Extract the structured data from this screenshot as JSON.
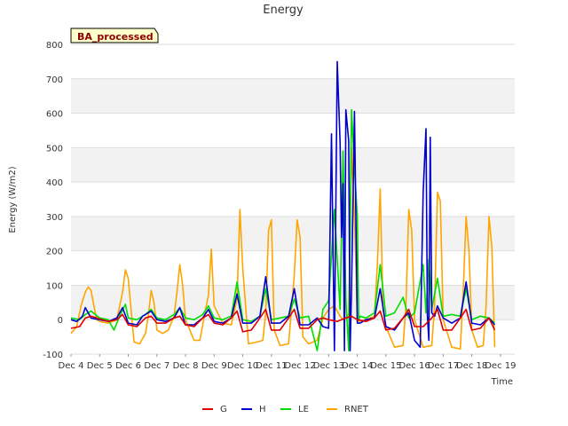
{
  "chart_data": {
    "type": "line",
    "title": "Energy",
    "xlabel": "Time",
    "ylabel": "Energy (W/m2)",
    "badge": "BA_processed",
    "ylim": [
      -100,
      800
    ],
    "yticks": [
      -100,
      0,
      100,
      200,
      300,
      400,
      500,
      600,
      700,
      800
    ],
    "xlim": [
      0,
      15.5
    ],
    "xtick_labels": [
      "Dec 4",
      "Dec 5",
      "Dec 6",
      "Dec 7",
      "Dec 8",
      "Dec 9",
      "Dec 10",
      "Dec 11",
      "Dec 12",
      "Dec 13",
      "Dec 14",
      "Dec 15",
      "Dec 16",
      "Dec 17",
      "Dec 18",
      "Dec 19"
    ],
    "legend_position": "bottom",
    "grid": true,
    "series": [
      {
        "name": "G",
        "color": "#dd0000",
        "x": [
          0.0,
          0.3,
          0.5,
          0.7,
          1.0,
          1.3,
          1.6,
          1.8,
          2.0,
          2.3,
          2.6,
          2.8,
          3.0,
          3.3,
          3.6,
          3.8,
          4.0,
          4.3,
          4.6,
          4.8,
          5.0,
          5.3,
          5.6,
          5.8,
          6.0,
          6.3,
          6.6,
          6.8,
          7.0,
          7.3,
          7.6,
          7.8,
          8.0,
          8.3,
          8.6,
          8.8,
          9.0,
          9.3,
          9.6,
          9.8,
          10.0,
          10.3,
          10.6,
          10.8,
          11.0,
          11.3,
          11.6,
          11.8,
          12.0,
          12.3,
          12.6,
          12.8,
          13.0,
          13.3,
          13.6,
          13.8,
          14.0,
          14.3,
          14.6,
          14.8
        ],
        "y": [
          -25,
          -20,
          5,
          10,
          2,
          -5,
          0,
          15,
          -15,
          -20,
          5,
          10,
          -10,
          -10,
          5,
          10,
          -15,
          -20,
          5,
          15,
          -10,
          -15,
          5,
          25,
          -35,
          -30,
          5,
          30,
          -30,
          -30,
          5,
          30,
          -25,
          -25,
          0,
          5,
          0,
          -5,
          5,
          10,
          0,
          -5,
          5,
          25,
          -30,
          -25,
          5,
          30,
          -20,
          -20,
          5,
          30,
          -30,
          -30,
          5,
          30,
          -30,
          -25,
          5,
          -30
        ]
      },
      {
        "name": "H",
        "color": "#0000cc",
        "x": [
          0.0,
          0.2,
          0.4,
          0.5,
          0.7,
          1.0,
          1.3,
          1.6,
          1.8,
          2.0,
          2.3,
          2.5,
          2.8,
          3.0,
          3.3,
          3.6,
          3.8,
          4.0,
          4.3,
          4.6,
          4.8,
          5.0,
          5.3,
          5.6,
          5.8,
          6.0,
          6.3,
          6.6,
          6.8,
          7.0,
          7.3,
          7.6,
          7.8,
          8.0,
          8.3,
          8.6,
          8.8,
          9.0,
          9.1,
          9.2,
          9.3,
          9.4,
          9.45,
          9.5,
          9.55,
          9.6,
          9.7,
          9.75,
          9.8,
          9.9,
          10.0,
          10.1,
          10.2,
          10.3,
          10.6,
          10.8,
          11.0,
          11.3,
          11.6,
          11.8,
          12.0,
          12.2,
          12.3,
          12.4,
          12.45,
          12.5,
          12.55,
          12.6,
          12.7,
          12.8,
          13.0,
          13.3,
          13.6,
          13.8,
          14.0,
          14.3,
          14.6,
          14.8
        ],
        "y": [
          0,
          -5,
          10,
          35,
          5,
          0,
          -5,
          5,
          35,
          -10,
          -15,
          10,
          25,
          0,
          -5,
          5,
          35,
          -15,
          -15,
          5,
          30,
          -5,
          -10,
          5,
          75,
          -10,
          -10,
          10,
          125,
          -10,
          -10,
          10,
          90,
          -15,
          -15,
          5,
          -20,
          -25,
          540,
          -90,
          750,
          515,
          240,
          395,
          -90,
          610,
          520,
          -90,
          90,
          605,
          -10,
          -10,
          -5,
          0,
          5,
          90,
          -20,
          -30,
          5,
          20,
          -60,
          -80,
          370,
          555,
          10,
          -60,
          530,
          20,
          10,
          40,
          5,
          -10,
          5,
          110,
          -10,
          -15,
          5,
          -15
        ]
      },
      {
        "name": "LE",
        "color": "#00dd00",
        "x": [
          0.0,
          0.3,
          0.5,
          0.7,
          1.0,
          1.3,
          1.5,
          1.7,
          1.9,
          2.0,
          2.3,
          2.6,
          2.8,
          3.0,
          3.3,
          3.6,
          3.8,
          4.0,
          4.3,
          4.6,
          4.8,
          5.0,
          5.3,
          5.6,
          5.8,
          6.0,
          6.3,
          6.6,
          6.8,
          7.0,
          7.3,
          7.6,
          7.8,
          8.0,
          8.3,
          8.6,
          8.8,
          9.0,
          9.2,
          9.4,
          9.5,
          9.6,
          9.7,
          9.8,
          9.9,
          10.0,
          10.05,
          10.1,
          10.3,
          10.6,
          10.8,
          11.0,
          11.3,
          11.6,
          11.8,
          12.0,
          12.3,
          12.4,
          12.5,
          12.6,
          12.8,
          13.0,
          13.3,
          13.6,
          13.8,
          14.0,
          14.3,
          14.6,
          14.8
        ],
        "y": [
          5,
          0,
          15,
          25,
          5,
          0,
          -30,
          10,
          45,
          5,
          0,
          15,
          30,
          5,
          0,
          15,
          35,
          5,
          0,
          15,
          40,
          5,
          0,
          10,
          110,
          0,
          -5,
          10,
          90,
          0,
          5,
          10,
          60,
          5,
          10,
          -90,
          30,
          55,
          320,
          30,
          490,
          60,
          -90,
          610,
          440,
          300,
          0,
          10,
          5,
          20,
          160,
          10,
          20,
          65,
          5,
          20,
          160,
          20,
          175,
          30,
          120,
          10,
          15,
          10,
          90,
          0,
          10,
          5,
          -10
        ]
      },
      {
        "name": "RNET",
        "color": "#ffa500",
        "x": [
          0.0,
          0.2,
          0.35,
          0.5,
          0.6,
          0.7,
          0.8,
          0.9,
          1.0,
          1.3,
          1.6,
          1.8,
          1.9,
          2.0,
          2.2,
          2.4,
          2.6,
          2.7,
          2.8,
          2.9,
          3.0,
          3.2,
          3.4,
          3.6,
          3.7,
          3.8,
          3.9,
          4.0,
          4.3,
          4.5,
          4.7,
          4.8,
          4.9,
          5.0,
          5.3,
          5.6,
          5.8,
          5.9,
          6.0,
          6.2,
          6.5,
          6.7,
          6.8,
          6.9,
          7.0,
          7.1,
          7.3,
          7.6,
          7.8,
          7.9,
          8.0,
          8.1,
          8.3,
          8.6,
          8.8,
          9.0,
          9.2,
          9.4,
          9.5,
          9.6,
          9.7,
          9.8,
          9.9,
          10.0,
          10.3,
          10.6,
          10.7,
          10.8,
          10.9,
          11.0,
          11.3,
          11.6,
          11.7,
          11.8,
          11.9,
          12.0,
          12.3,
          12.6,
          12.7,
          12.8,
          12.9,
          13.0,
          13.3,
          13.6,
          13.7,
          13.8,
          13.9,
          14.0,
          14.2,
          14.4,
          14.5,
          14.6,
          14.7,
          14.8
        ],
        "y": [
          -40,
          -20,
          40,
          80,
          95,
          85,
          40,
          0,
          -5,
          -10,
          0,
          80,
          145,
          120,
          -65,
          -70,
          -40,
          10,
          85,
          50,
          -30,
          -40,
          -30,
          10,
          80,
          160,
          100,
          0,
          -60,
          -60,
          30,
          70,
          205,
          40,
          -10,
          -15,
          60,
          320,
          150,
          -70,
          -65,
          -60,
          20,
          260,
          290,
          -30,
          -75,
          -70,
          130,
          290,
          240,
          -50,
          -70,
          -60,
          5,
          30,
          40,
          10,
          0,
          5,
          15,
          500,
          300,
          -5,
          0,
          10,
          160,
          380,
          30,
          -20,
          -80,
          -75,
          40,
          320,
          260,
          0,
          -80,
          -75,
          40,
          370,
          345,
          0,
          -80,
          -85,
          80,
          300,
          200,
          -30,
          -80,
          -75,
          40,
          300,
          210,
          -80
        ]
      }
    ]
  }
}
